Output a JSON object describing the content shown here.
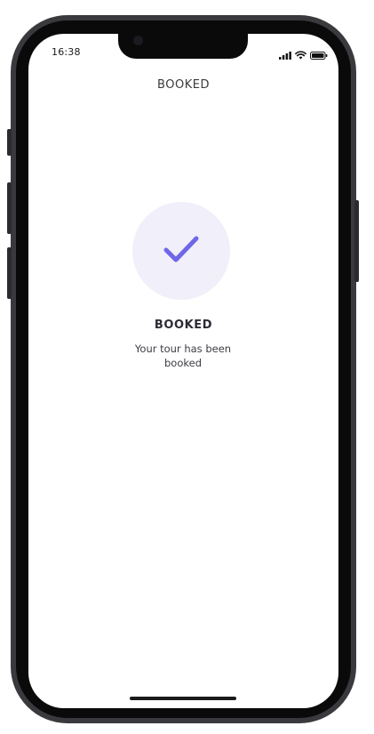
{
  "status_bar": {
    "time": "16:38",
    "icons": [
      "signal-icon",
      "wifi-icon",
      "battery-icon"
    ]
  },
  "header": {
    "title": "BOOKED"
  },
  "confirmation": {
    "icon": "checkmark-icon",
    "title": "BOOKED",
    "message": "Your tour has been booked"
  },
  "colors": {
    "accent": "#6f66e8",
    "circle_bg": "#f1eff9",
    "frame": "#3a3a3e"
  }
}
